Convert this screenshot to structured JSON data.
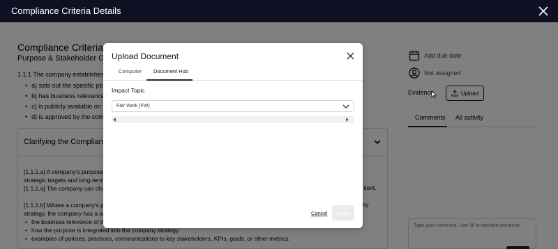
{
  "header": {
    "title": "Compliance Criteria Details"
  },
  "criteria": {
    "title": "Compliance Criteria 1",
    "subtitle": "Purpose & Stakeholder Govern",
    "intro": "1.1.1 The company establishes a p",
    "items": [
      "a) sets out the specific positi",
      "b) has business relevance a",
      "c) is publicly available on the",
      "d) is approved by the compa"
    ]
  },
  "accordion": {
    "title": "Clarifying the Compliance",
    "lines_a": [
      "[1.1.1.a] A company's purpose st",
      "strategic targets and long-term s",
      "[1.1.1.a] The company can choos"
    ],
    "right_a": [
      "s",
      "ontext."
    ],
    "lines_b": [
      "[1.1.1.b] Where a company's pur",
      "strategy, the company has a sup"
    ],
    "right_b": "my",
    "bullets": [
      "the business relevance of the",
      "how the purpose is integrated into the company strategy",
      "examples of policies, practices, communications to key stakeholders, KPIs, goals, or other metrics."
    ]
  },
  "side": {
    "due_date": "Add due date",
    "assignee": "Not assigned",
    "evidence_label": "Evidence",
    "upload_label": "Upload",
    "tabs": [
      "Comments",
      "All activity"
    ],
    "comment_placeholder": "Type your comment. Use @ to mention someone."
  },
  "modal": {
    "title": "Upload Document",
    "tabs": [
      "Computer",
      "Document Hub"
    ],
    "active_tab": "Document Hub",
    "field_label": "Impact Topic",
    "select_value": "Fair Work (FW)",
    "cancel_label": "Cancel",
    "save_label": "Save"
  },
  "icons": {
    "close": "close-icon",
    "calendar": "calendar-icon",
    "user": "user-icon",
    "upload": "upload-icon",
    "chevron": "chevron-down-icon"
  }
}
